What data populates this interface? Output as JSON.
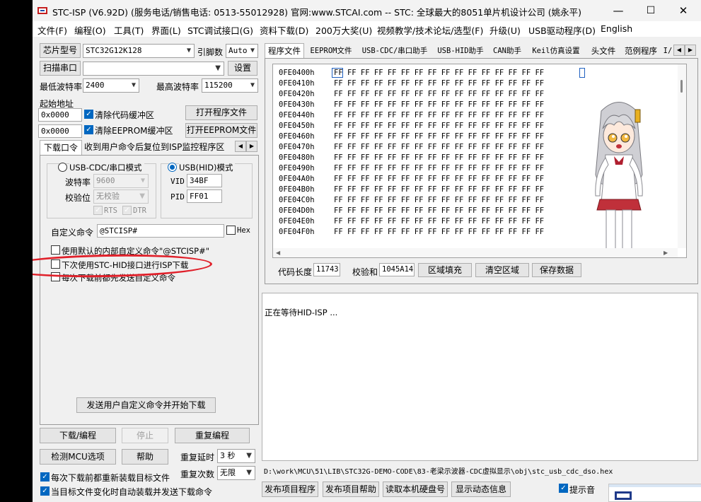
{
  "window": {
    "title": "STC-ISP (V6.92D) (服务电话/销售电话: 0513-55012928) 官网:www.STCAI.com  -- STC: 全球最大的8051单片机设计公司 (姚永平)",
    "minimize": "—",
    "maximize": "☐",
    "close": "✕"
  },
  "menu": [
    "文件(F)",
    "编程(O)",
    "工具(T)",
    "界面(L)",
    "STC调试接口(G)",
    "资料下载(D)",
    "200万大奖(U)",
    "视频教学/技术论坛/选型(F)",
    "升级(U)",
    "USB驱动程序(D)",
    "English"
  ],
  "left": {
    "chip_type_btn": "芯片型号",
    "chip_type_value": "STC32G12K128",
    "pin_count_label": "引脚数",
    "pin_count_value": "Auto",
    "scan_port_btn": "扫描串口",
    "port_value": "",
    "settings_btn": "设置",
    "min_baud_label": "最低波特率",
    "min_baud_value": "2400",
    "max_baud_label": "最高波特率",
    "max_baud_value": "115200",
    "start_addr_label": "起始地址",
    "code_addr": "0x0000",
    "clear_code_buf": "清除代码缓冲区",
    "open_prog_btn": "打开程序文件",
    "eeprom_addr": "0x0000",
    "clear_eeprom_buf": "清除EEPROM缓冲区",
    "open_eeprom_btn": "打开EEPROM文件",
    "tab_download": "下载口令",
    "tab_reset": "收到用户命令后复位到ISP监控程序区",
    "usb_cdc_mode": "USB-CDC/串口模式",
    "usb_hid_mode": "USB(HID)模式",
    "baud_label": "波特率",
    "baud_value": "9600",
    "parity_label": "校验位",
    "parity_value": "无校验",
    "rts_label": "RTS",
    "dtr_label": "DTR",
    "vid_label": "VID",
    "vid_value": "34BF",
    "pid_label": "PID",
    "pid_value": "FF01",
    "custom_cmd_label": "自定义命令",
    "custom_cmd_value": "@STCISP#",
    "hex_label": "Hex",
    "use_default_cmd": "使用默认的内部自定义命令\"@STCISP#\"",
    "next_use_hid": "下次使用STC-HID接口进行ISP下载",
    "send_before_download": "每次下载前都先发送自定义命令",
    "send_cmd_btn": "发送用户自定义命令并开始下载",
    "download_btn": "下载/编程",
    "stop_btn": "停止",
    "reprogram_btn": "重复编程",
    "detect_btn": "检测MCU选项",
    "help_btn": "帮助",
    "repeat_delay_label": "重复延时",
    "repeat_delay_value": "3 秒",
    "repeat_count_label": "重复次数",
    "repeat_count_value": "无限",
    "reload_before": "每次下载前都重新装载目标文件",
    "auto_reload": "当目标文件变化时自动装载并发送下载命令"
  },
  "right": {
    "tabs": [
      "程序文件",
      "EEPROM文件",
      "USB-CDC/串口助手",
      "USB-HID助手",
      "CAN助手",
      "Keil仿真设置",
      "头文件",
      "范例程序",
      "I/"
    ],
    "hex_addresses": [
      "0FE0400h",
      "0FE0410h",
      "0FE0420h",
      "0FE0430h",
      "0FE0440h",
      "0FE0450h",
      "0FE0460h",
      "0FE0470h",
      "0FE0480h",
      "0FE0490h",
      "0FE04A0h",
      "0FE04B0h",
      "0FE04C0h",
      "0FE04D0h",
      "0FE04E0h",
      "0FE04F0h"
    ],
    "hex_bytes": "FF FF FF FF FF FF FF FF FF FF FF FF FF FF FF FF",
    "code_len_label": "代码长度",
    "code_len_value": "11743",
    "checksum_label": "校验和",
    "checksum_value": "1045A14",
    "fill_btn": "区域填充",
    "clear_btn": "清空区域",
    "save_btn": "保存数据",
    "log_text": "正在等待HID-ISP ...",
    "file_path": "D:\\work\\MCU\\51\\LIB\\STC32G-DEMO-CODE\\83-老梁示波器-CDC虚拟显示\\obj\\stc_usb_cdc_dso.hex",
    "publish_prog_btn": "发布项目程序",
    "publish_help_btn": "发布项目帮助",
    "read_disk_btn": "读取本机硬盘号",
    "show_dynamic_btn": "显示动态信息",
    "beep_label": "提示音"
  }
}
